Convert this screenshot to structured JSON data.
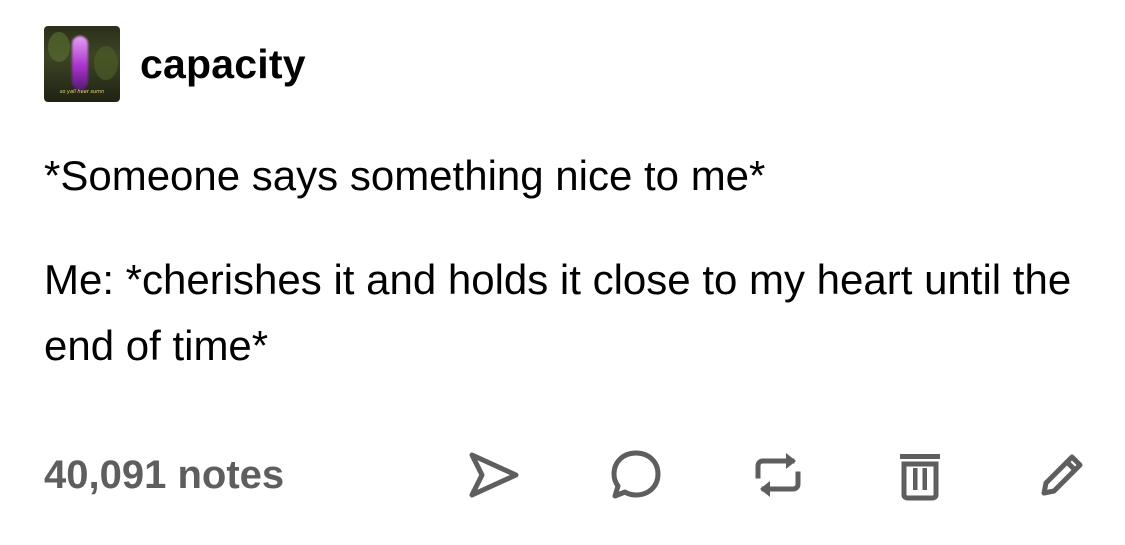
{
  "post": {
    "username": "capacity",
    "avatar_caption": "so yall hear sumn",
    "line1": "*Someone says something nice to me*",
    "line2": "Me: *cherishes it and holds it close to my heart until the end of time*"
  },
  "footer": {
    "notes": "40,091 notes",
    "actions": [
      "share-icon",
      "comment-icon",
      "reblog-icon",
      "delete-icon",
      "edit-icon"
    ]
  },
  "colors": {
    "text": "#000000",
    "notes": "#5e5e5e",
    "icon": "#5e5e5e",
    "avatar_glow": "#b133d9"
  }
}
